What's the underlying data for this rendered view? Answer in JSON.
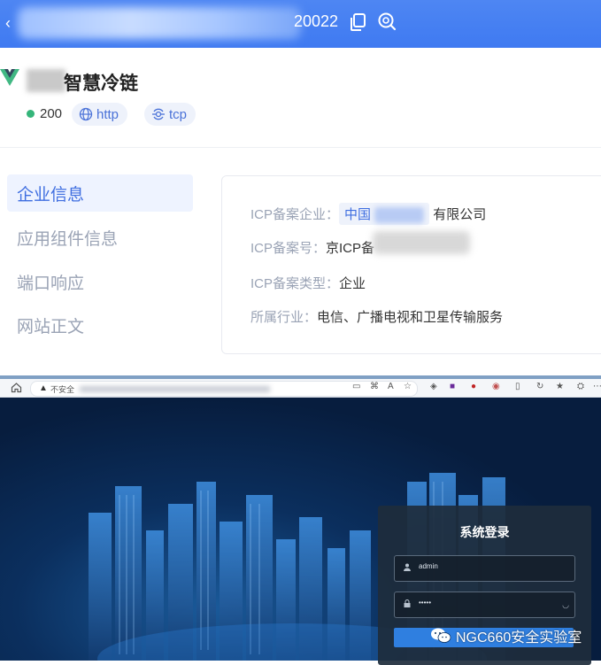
{
  "address_bar": {
    "url_suffix": "20022"
  },
  "header": {
    "site_title": "智慧冷链",
    "status_code": "200",
    "protocols": [
      "http",
      "tcp"
    ]
  },
  "sidebar": {
    "items": [
      {
        "label": "企业信息",
        "active": true
      },
      {
        "label": "应用组件信息",
        "active": false
      },
      {
        "label": "端口响应",
        "active": false
      },
      {
        "label": "网站正文",
        "active": false
      }
    ]
  },
  "icp": {
    "company_label": "ICP备案企业：",
    "company_prefix": "中国",
    "company_suffix": "有限公司",
    "number_label": "ICP备案号：",
    "number_value": "京ICP备",
    "type_label": "ICP备案类型：",
    "type_value": "企业",
    "industry_label": "所属行业：",
    "industry_value": "电信、广播电视和卫星传输服务"
  },
  "inner_browser": {
    "security_text": "不安全"
  },
  "login": {
    "title": "系统登录",
    "username": "admin",
    "password_mask": "•••••"
  },
  "watermark": "NGC660安全实验室",
  "colors": {
    "accent": "#3f6ee0",
    "topbar": "#4e86f3",
    "status_ok": "#35b57a"
  }
}
